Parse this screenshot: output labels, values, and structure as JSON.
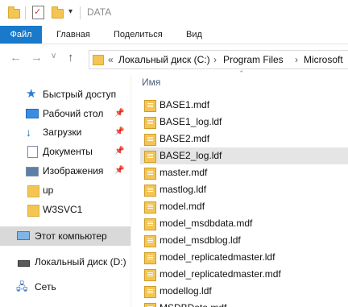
{
  "window": {
    "title": "DATA"
  },
  "ribbon": {
    "tabs": [
      "Файл",
      "Главная",
      "Поделиться",
      "Вид"
    ]
  },
  "address": {
    "overflow": "«",
    "crumbs": [
      "Локальный диск (C:)",
      "Program Files",
      "Microsoft"
    ]
  },
  "nav": {
    "items": [
      {
        "label": "Быстрый доступ",
        "icon": "star-icon",
        "pinned": false
      },
      {
        "label": "Рабочий стол",
        "icon": "desktop-icon",
        "pinned": true
      },
      {
        "label": "Загрузки",
        "icon": "download-icon",
        "pinned": true
      },
      {
        "label": "Документы",
        "icon": "document-icon",
        "pinned": true
      },
      {
        "label": "Изображения",
        "icon": "picture-icon",
        "pinned": true
      },
      {
        "label": "up",
        "icon": "folder-icon",
        "pinned": false
      },
      {
        "label": "W3SVC1",
        "icon": "folder-icon",
        "pinned": false
      },
      {
        "label": "Этот компьютер",
        "icon": "computer-icon",
        "selected": true
      },
      {
        "label": "Локальный диск (D:)",
        "icon": "drive-icon"
      },
      {
        "label": "Сеть",
        "icon": "network-icon"
      }
    ]
  },
  "list": {
    "header": "Имя",
    "files": [
      "BASE1.mdf",
      "BASE1_log.ldf",
      "BASE2.mdf",
      "BASE2_log.ldf",
      "master.mdf",
      "mastlog.ldf",
      "model.mdf",
      "model_msdbdata.mdf",
      "model_msdblog.ldf",
      "model_replicatedmaster.ldf",
      "model_replicatedmaster.mdf",
      "modellog.ldf",
      "MSDBData.mdf"
    ],
    "selected_index": 3
  }
}
